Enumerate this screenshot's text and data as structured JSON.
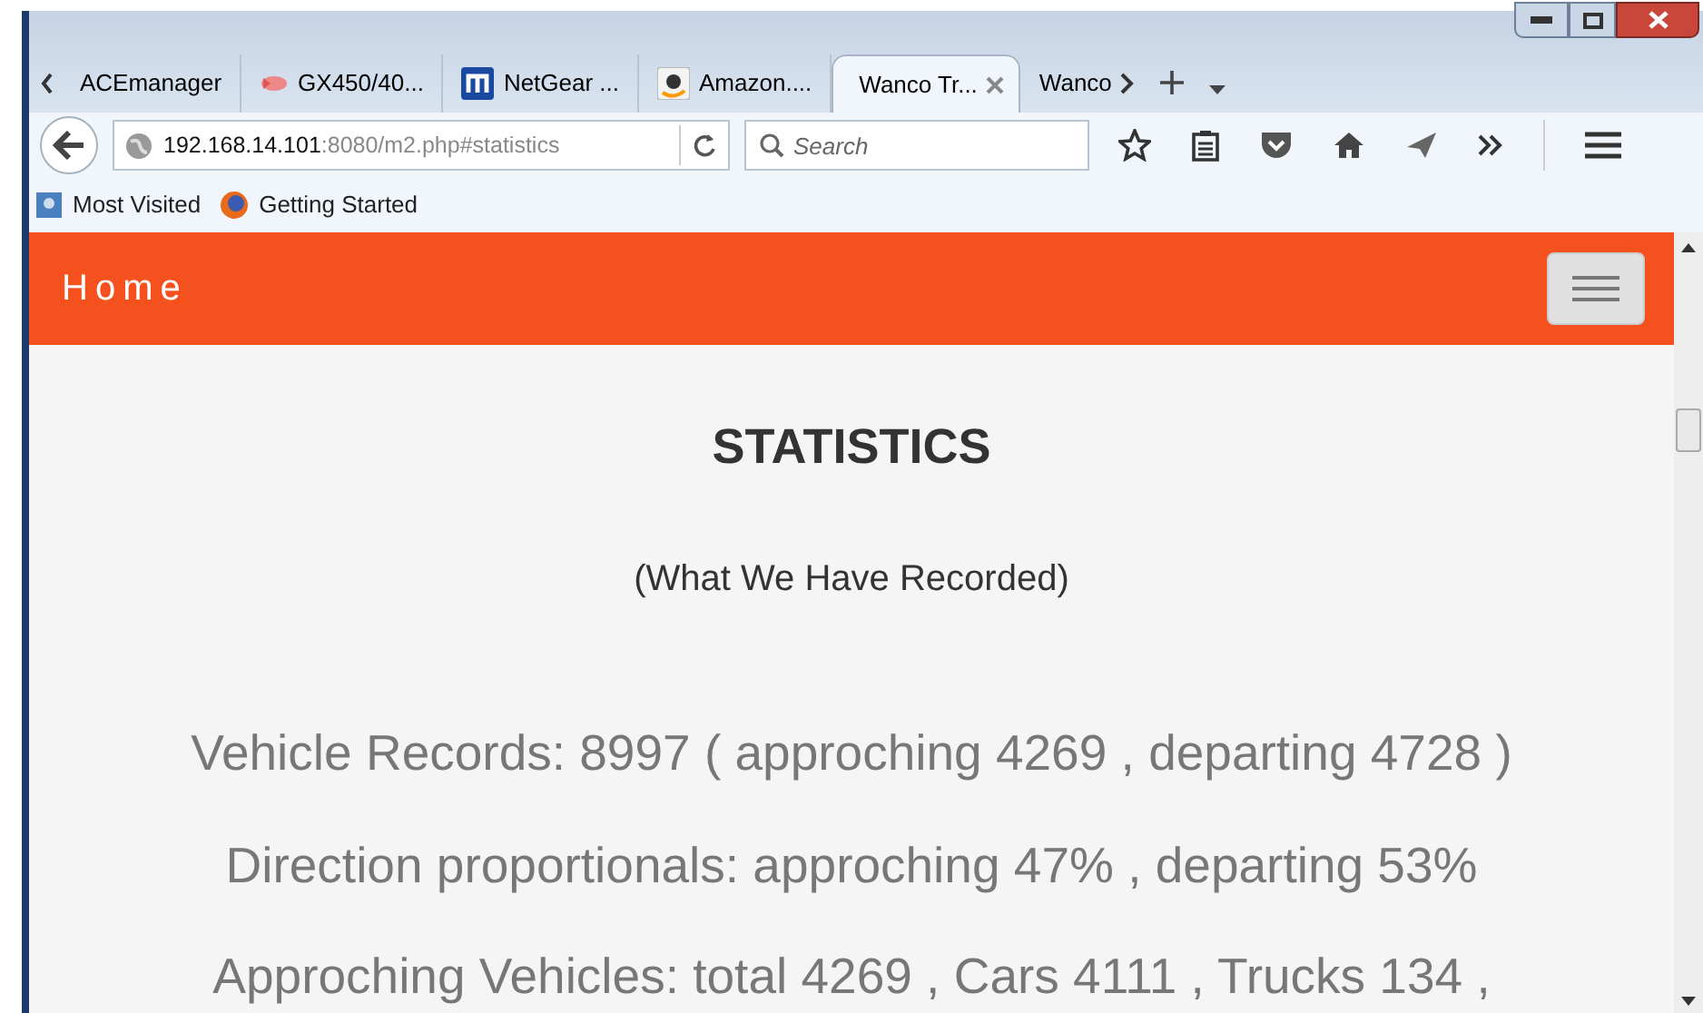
{
  "tabs": [
    {
      "label": "ACEmanager",
      "selected": false,
      "closable": false
    },
    {
      "label": "GX450/40...",
      "selected": false,
      "closable": false
    },
    {
      "label": "NetGear ...",
      "selected": false,
      "closable": false
    },
    {
      "label": "Amazon....",
      "selected": false,
      "closable": false
    },
    {
      "label": "Wanco Tr...",
      "selected": true,
      "closable": true
    },
    {
      "label": "Wanco",
      "selected": false,
      "closable": false
    }
  ],
  "address": {
    "host": "192.168.14.101",
    "path": ":8080/m2.php#statistics"
  },
  "search": {
    "placeholder": "Search"
  },
  "bookmarks": [
    {
      "label": "Most Visited"
    },
    {
      "label": "Getting Started"
    }
  ],
  "navbar": {
    "brand": "Home"
  },
  "page": {
    "title": "STATISTICS",
    "subtitle": "(What We Have Recorded)",
    "lines": [
      "Vehicle Records: 8997 ( approching 4269 , departing 4728 )",
      "Direction proportionals: approching 47% , departing 53%",
      "Approching Vehicles: total 4269 , Cars 4111 , Trucks 134 ,"
    ]
  }
}
